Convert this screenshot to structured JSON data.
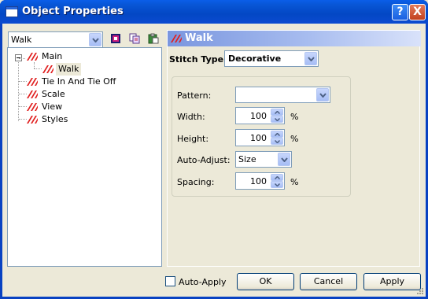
{
  "window": {
    "title": "Object Properties"
  },
  "titlebar_buttons": {
    "help": "?",
    "close": "X"
  },
  "left_pane": {
    "combo_value": "Walk",
    "toolbar_icons": [
      "color-palette-icon",
      "copy-icon",
      "paste-icon"
    ],
    "tree": {
      "root": {
        "label": "Main",
        "child": "Walk"
      },
      "items": [
        "Tie In And Tie Off",
        "Scale",
        "View",
        "Styles"
      ]
    }
  },
  "right_pane": {
    "header": "Walk",
    "stitch_type_label": "Stitch Type:",
    "stitch_type_value": "Decorative",
    "fields": {
      "pattern_label": "Pattern:",
      "pattern_value": "",
      "width_label": "Width:",
      "width_value": "100",
      "width_unit": "%",
      "height_label": "Height:",
      "height_value": "100",
      "height_unit": "%",
      "auto_adjust_label": "Auto-Adjust:",
      "auto_adjust_value": "Size",
      "spacing_label": "Spacing:",
      "spacing_value": "100",
      "spacing_unit": "%"
    }
  },
  "footer": {
    "auto_apply_label": "Auto-Apply",
    "auto_apply_checked": false,
    "ok": "OK",
    "cancel": "Cancel",
    "apply": "Apply"
  },
  "colors": {
    "titlebar": "#0a5ee8",
    "accent_red": "#e02020",
    "panel_header": "#7a96df"
  }
}
